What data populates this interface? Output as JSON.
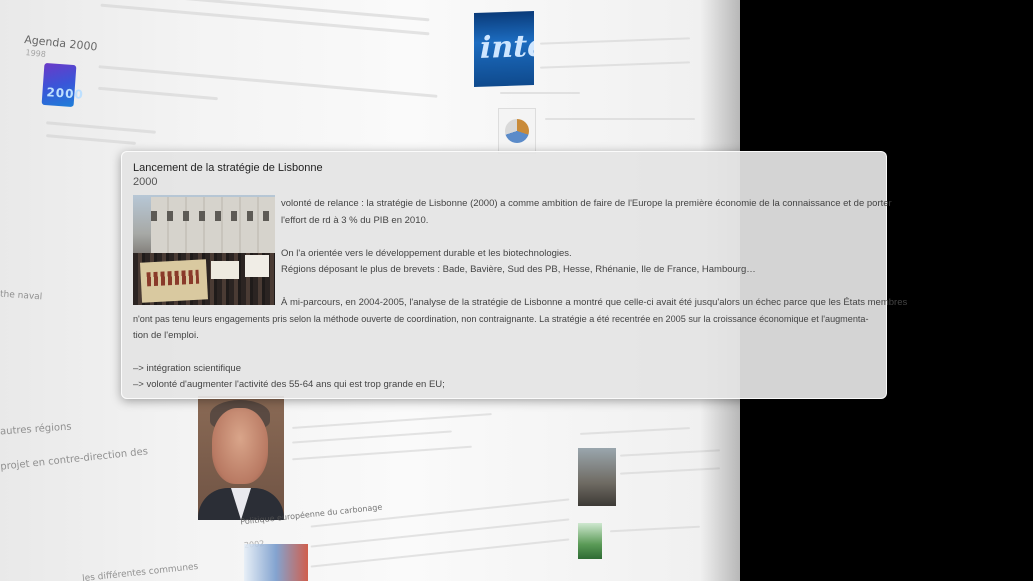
{
  "background": {
    "agenda": {
      "title": "Agenda 2000",
      "year": "1998",
      "logo_text": "2000"
    },
    "intel_logo_text": "intel",
    "left_fragments": [
      "the naval",
      "autres régions",
      "projet en contre-direction des"
    ],
    "lower_heading": "Politique européenne du carbonage",
    "lower_year": "2002",
    "bottom_fragment": "les différentes communes"
  },
  "popup": {
    "title": "Lancement de la stratégie de Lisbonne",
    "year": "2000",
    "lines": [
      "volonté de relance : la stratégie de Lisbonne (2000) a comme ambition de faire de l'Europe la première économie de la connaissance et de porter",
      "l'effort de rd à 3 % du PIB en 2010.",
      "On l'a orientée vers le développement durable et les biotechnologies.",
      "Régions déposant le plus de brevets : Bade, Bavière, Sud des PB, Hesse, Rhénanie, Ile de France, Hambourg…",
      "À mi-parcours, en 2004-2005, l'analyse de la stratégie de Lisbonne a montré que celle-ci avait été jusqu'alors un échec parce que les États membres",
      "n'ont pas tenu leurs engagements pris selon la méthode ouverte de coordination, non contraignante. La stratégie a été recentrée en 2005 sur la croissance économique et l'augmenta-",
      "tion de l'emploi.",
      "–> intégration scientifique",
      "–> volonté d'augmenter l'activité des 55-64 ans qui est trop grande en EU;"
    ]
  }
}
